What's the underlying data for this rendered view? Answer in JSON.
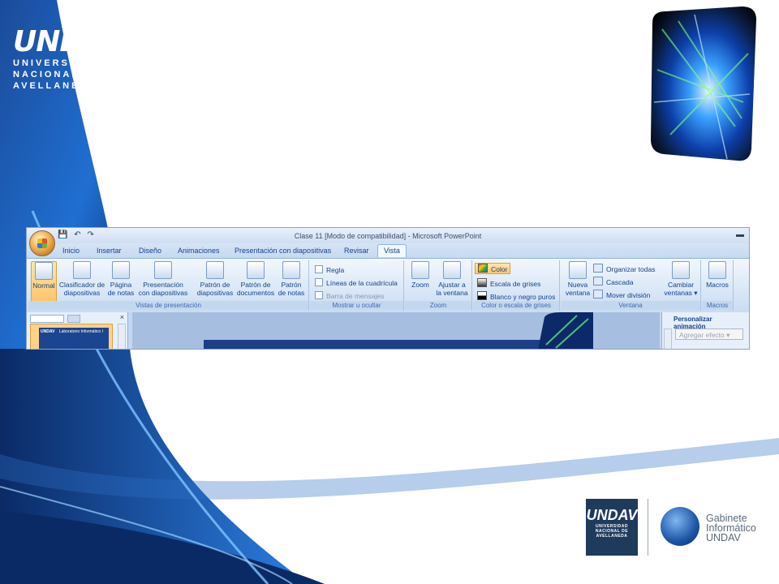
{
  "logo": {
    "mark": "UNDAV",
    "line1": "UNIVERSIDAD",
    "line2": "NACIONAL DE",
    "line3": "AVELLANEDA"
  },
  "window": {
    "title": "Clase 11 [Modo de compatibilidad] - Microsoft PowerPoint",
    "tabs": [
      "Inicio",
      "Insertar",
      "Diseño",
      "Animaciones",
      "Presentación con diapositivas",
      "Revisar",
      "Vista"
    ],
    "active_tab": "Vista"
  },
  "ribbon": {
    "vistas": {
      "label": "Vistas de presentación",
      "normal": "Normal",
      "clasificador": [
        "Clasificador de",
        "diapositivas"
      ],
      "pagina": [
        "Página",
        "de notas"
      ],
      "presentacion": [
        "Presentación",
        "con diapositivas"
      ],
      "patron_diap": [
        "Patrón de",
        "diapositivas"
      ],
      "patron_doc": [
        "Patrón de",
        "documentos"
      ],
      "patron_notas": [
        "Patrón",
        "de notas"
      ]
    },
    "mostrar": {
      "label": "Mostrar u ocultar",
      "regla": "Regla",
      "lineas": "Líneas de la cuadrícula",
      "barra": "Barra de mensajes"
    },
    "zoom": {
      "label": "Zoom",
      "zoom": "Zoom",
      "ajustar": [
        "Ajustar a",
        "la ventana"
      ]
    },
    "color": {
      "label": "Color o escala de grises",
      "color": "Color",
      "escala": "Escala de grises",
      "blanco": "Blanco y negro puros"
    },
    "ventana": {
      "label": "Ventana",
      "nueva": [
        "Nueva",
        "ventana"
      ],
      "organizar": "Organizar todas",
      "cascada": "Cascada",
      "mover": "Mover división",
      "cambiar": [
        "Cambiar",
        "ventanas ▾"
      ]
    },
    "macros": {
      "label": "Macros",
      "macros": "Macros"
    }
  },
  "taskpane": {
    "title": "Personalizar animación",
    "add_effect": "Agregar efecto ▾"
  },
  "thumb": {
    "mark": "UNDAV",
    "text": "Laboratorio Informático I"
  },
  "footer": {
    "undav_mark": "UNDAV",
    "undav_text": [
      "UNIVERSIDAD",
      "NACIONAL DE",
      "AVELLANEDA"
    ],
    "gabinete": [
      "Gabinete",
      "Informático",
      "UNDAV"
    ]
  },
  "colors": {
    "accent": "#1f6fd1",
    "ribbon": "#dbe7f6",
    "selected": "#ffc46b"
  }
}
